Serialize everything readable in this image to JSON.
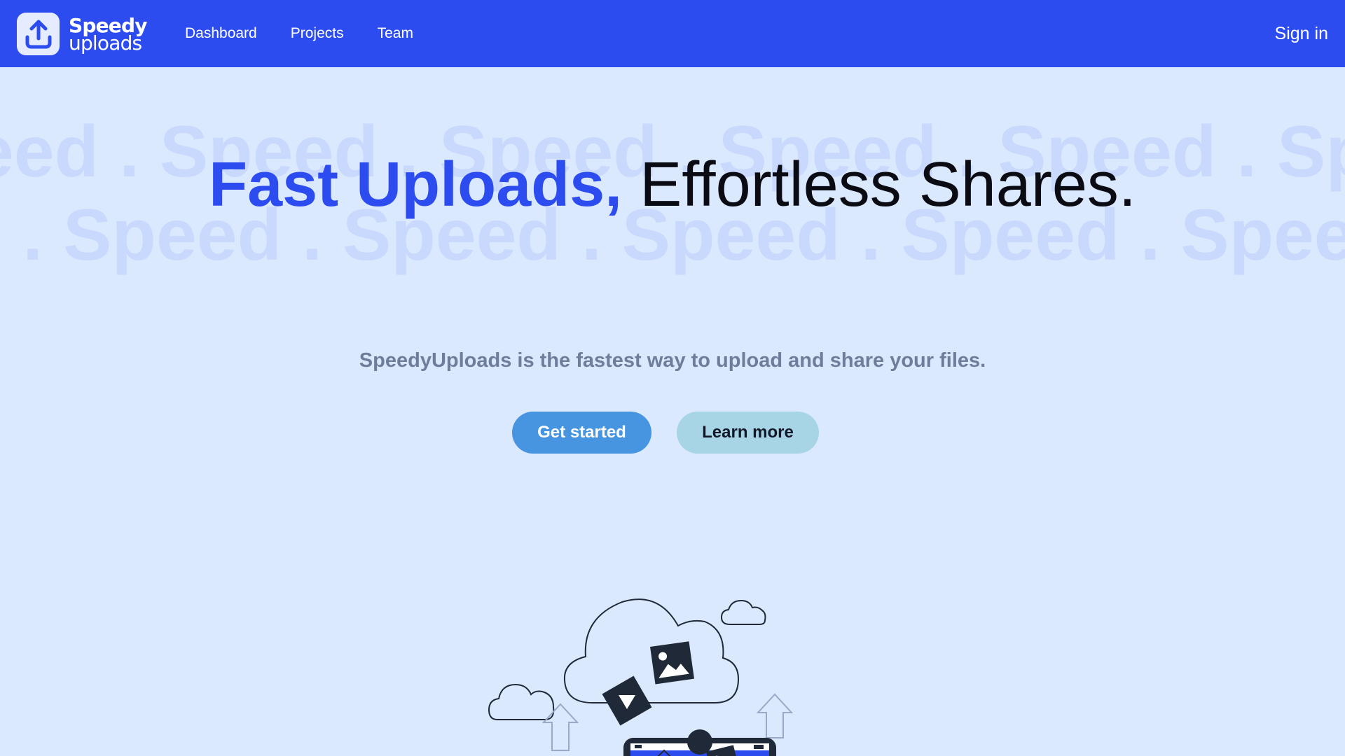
{
  "brand": {
    "line1": "Speedy",
    "line2": "uploads",
    "logo_icon": "upload-arrow-icon"
  },
  "nav": {
    "items": [
      {
        "label": "Dashboard"
      },
      {
        "label": "Projects"
      },
      {
        "label": "Team"
      }
    ],
    "sign_in": "Sign in"
  },
  "hero": {
    "background_word_row1": "eed . Speed . Speed . Speed . Speed . Speed . Sp",
    "background_word_row2": "ed . Speed . Speed . Speed . Speed . Speed . Spe",
    "headline_accent": "Fast Uploads,",
    "headline_rest": "Effortless Shares.",
    "subtitle": "SpeedyUploads is the fastest way to upload and share your files.",
    "primary_cta": "Get started",
    "secondary_cta": "Learn more"
  },
  "colors": {
    "nav_bg": "#2d4cf0",
    "page_bg": "#dbe9ff",
    "accent": "#2d4cf0",
    "primary_button": "#4794e0",
    "secondary_button": "#a8d5e6",
    "subtitle": "#6e7d99"
  }
}
